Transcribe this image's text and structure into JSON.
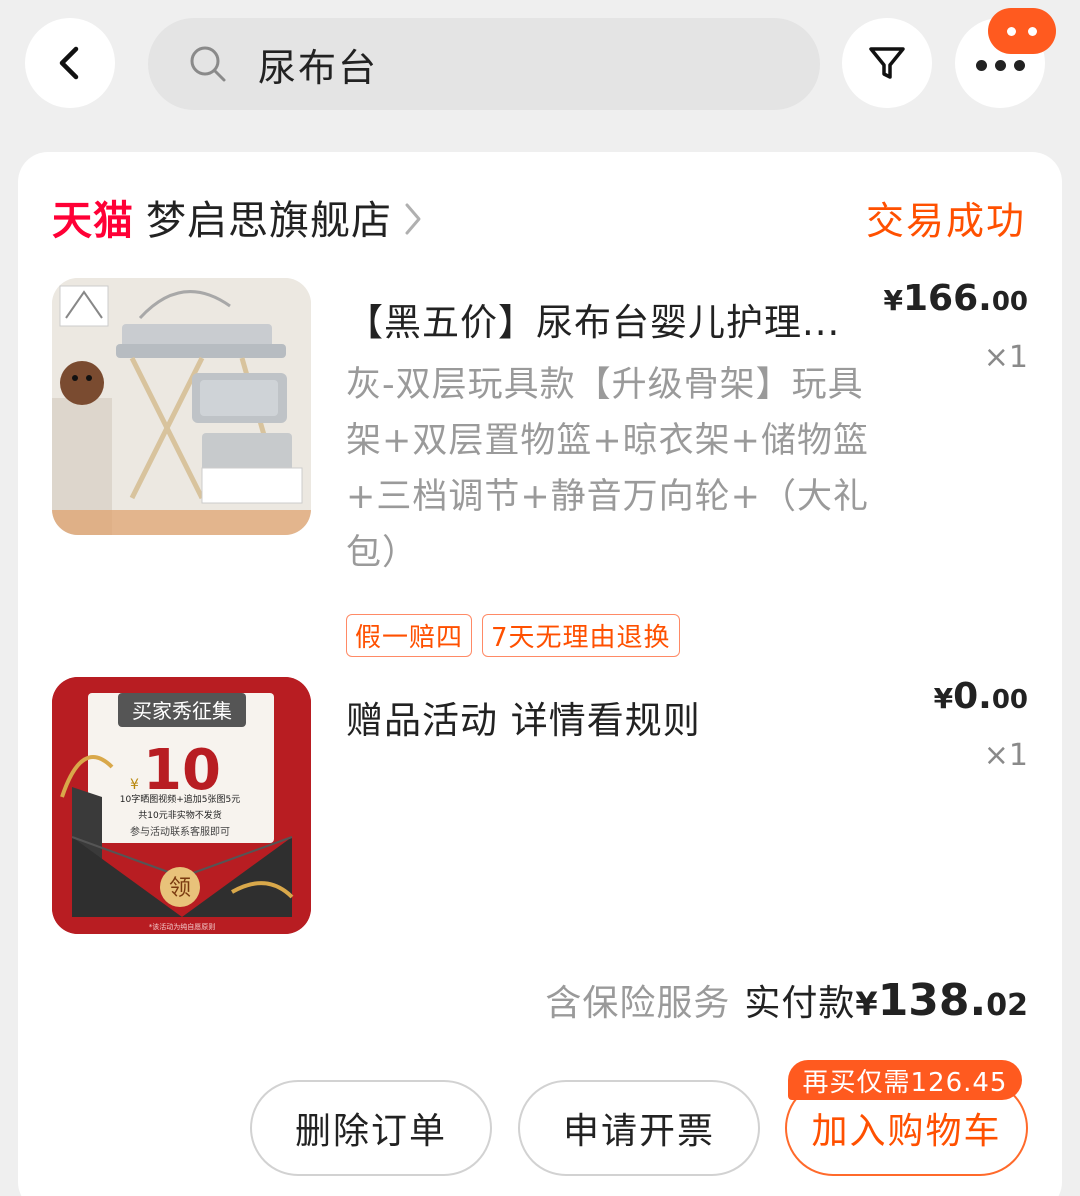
{
  "header": {
    "search_query": "尿布台"
  },
  "shop": {
    "platform_logo": "天猫",
    "name": "梦启思旗舰店",
    "order_status": "交易成功"
  },
  "items": [
    {
      "title": "【黑五价】尿布台婴儿护理...",
      "sku": "灰-双层玩具款【升级骨架】玩具架+双层置物篮+晾衣架+储物篮+三档调节+静音万向轮+（大礼包）",
      "price_currency": "¥",
      "price_int": "166.",
      "price_dec": "00",
      "qty": "×1",
      "tags": [
        "假一赔四",
        "7天无理由退换"
      ]
    },
    {
      "title": "赠品活动  详情看规则",
      "price_currency": "¥",
      "price_int": "0.",
      "price_dec": "00",
      "qty": "×1",
      "promo_card": {
        "banner": "买家秀征集",
        "currency": "¥",
        "amount": "10",
        "line1": "10字晒图视频+追加5张图5元",
        "line2": "共10元非实物不发货",
        "line3": "参与活动联系客服即可",
        "seal": "领",
        "footnote": "*该活动为纯自愿原则"
      }
    }
  ],
  "summary": {
    "insurance_note": "含保险服务",
    "paid_label": "实付款",
    "currency": "¥",
    "amount_int": "138.",
    "amount_dec": "02"
  },
  "actions": {
    "delete_label": "删除订单",
    "invoice_label": "申请开票",
    "add_cart_label": "加入购物车",
    "rebuy_note": "再买仅需126.45"
  },
  "colors": {
    "accent": "#ff5000",
    "tmall_red": "#ff0036",
    "background": "#efefef"
  }
}
